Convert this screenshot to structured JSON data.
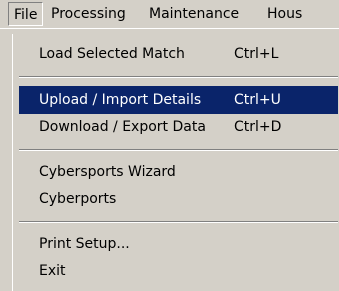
{
  "menubar": {
    "items": [
      {
        "label": "File"
      },
      {
        "label": "Processing"
      },
      {
        "label": "Maintenance"
      },
      {
        "label": "Hous"
      }
    ]
  },
  "file_menu": {
    "items": [
      {
        "label": "Load Selected Match",
        "shortcut": "Ctrl+L"
      },
      {
        "label": "Upload / Import Details",
        "shortcut": "Ctrl+U",
        "highlighted": true
      },
      {
        "label": "Download / Export Data",
        "shortcut": "Ctrl+D"
      },
      {
        "label": "Cybersports Wizard",
        "shortcut": ""
      },
      {
        "label": "Cyberports",
        "shortcut": ""
      },
      {
        "label": "Print Setup...",
        "shortcut": ""
      },
      {
        "label": "Exit",
        "shortcut": ""
      }
    ]
  },
  "colors": {
    "menu_background": "#d4d0c8",
    "highlight_background": "#0a246a",
    "highlight_text": "#ffffff"
  }
}
